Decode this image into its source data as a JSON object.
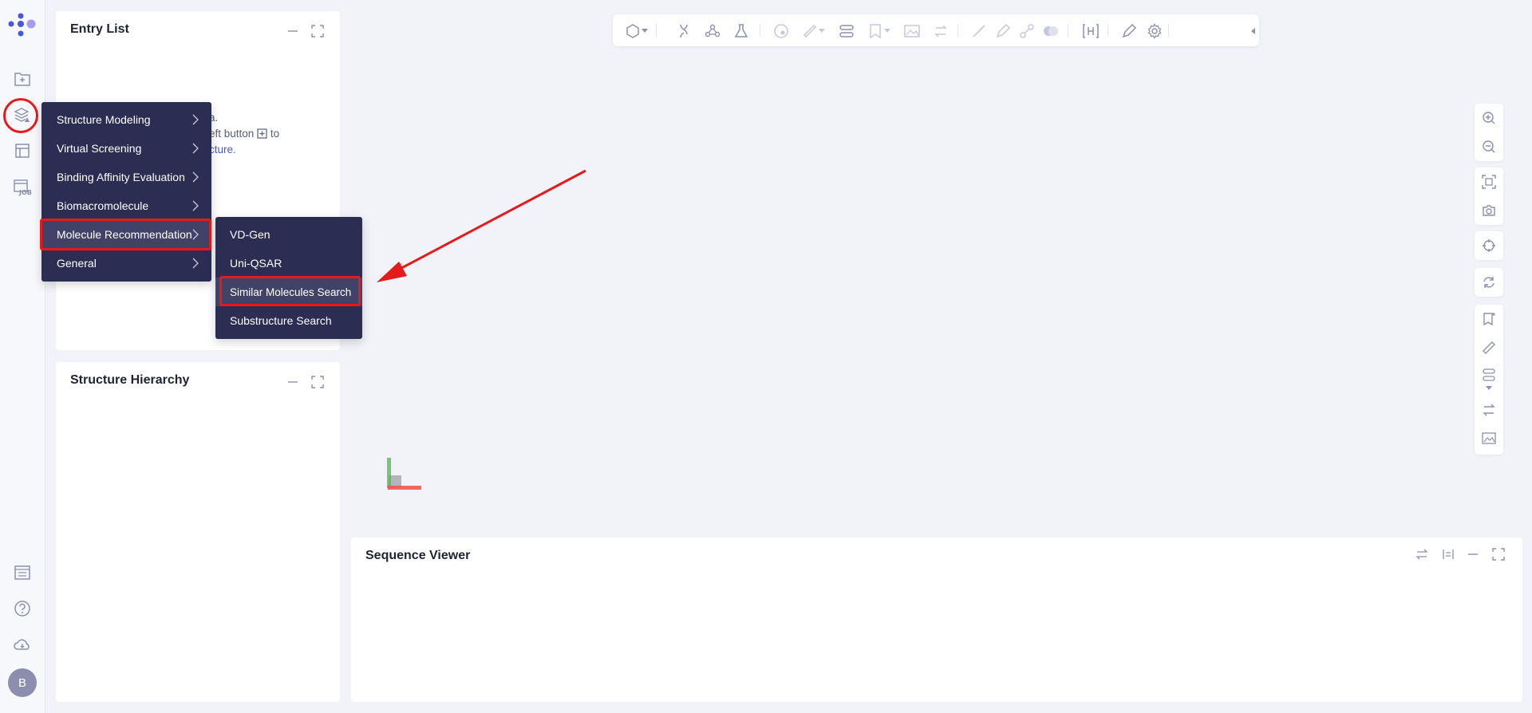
{
  "rail": {
    "avatar_letter": "B",
    "icons": [
      "new-folder-icon",
      "apps-icon",
      "table-icon",
      "job-icon",
      "list-icon",
      "help-icon",
      "cloud-icon"
    ]
  },
  "entry_list": {
    "title": "Entry List",
    "hint_line1": "a.",
    "hint_line2_pre": "eft button",
    "hint_line2_post": "to",
    "hint_line3_link": "cture."
  },
  "structure_hierarchy": {
    "title": "Structure Hierarchy"
  },
  "sequence_viewer": {
    "title": "Sequence Viewer"
  },
  "main_menu": {
    "items": [
      {
        "label": "Structure Modeling"
      },
      {
        "label": "Virtual Screening"
      },
      {
        "label": "Binding Affinity Evaluation"
      },
      {
        "label": "Biomacromolecule"
      },
      {
        "label": "Molecule Recommendation"
      },
      {
        "label": "General"
      }
    ],
    "selected": "Molecule Recommendation"
  },
  "sub_menu": {
    "items": [
      {
        "label": "VD-Gen"
      },
      {
        "label": "Uni-QSAR"
      },
      {
        "label": "Similar Molecules Search"
      },
      {
        "label": "Substructure Search"
      }
    ],
    "highlighted": "Similar Molecules Search"
  },
  "colors": {
    "menu_bg": "#2b2d52",
    "highlight": "#e51b1b",
    "accent": "#4a56d8"
  }
}
